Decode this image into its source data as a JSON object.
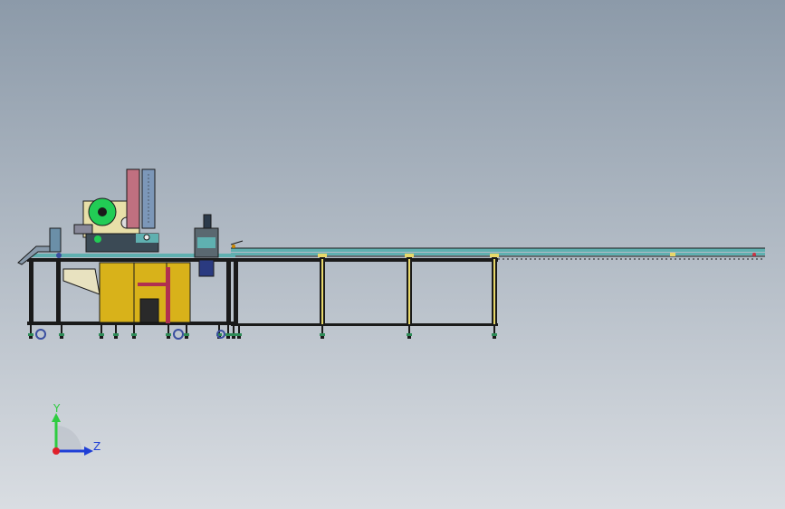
{
  "viewport": {
    "background_top": "#8c9aa9",
    "background_bottom": "#d9dde2"
  },
  "model": {
    "frame_color": "#1a1a1a",
    "cabinet_color": "#d8b21a",
    "leg_accent_color": "#e8d86a",
    "rail_color": "#5fb0b0",
    "roller_disc_color": "#22cc55",
    "tower_red_color": "#c07080",
    "tower_blue_color": "#7c97b8",
    "motor_color": "#5a6870",
    "foot_color": "#2e8b57",
    "caster_color": "#3a4fa0",
    "sheet_color": "#e8dfa8"
  },
  "triad": {
    "y_label": "Y",
    "z_label": "Z",
    "y_color": "#2ecc40",
    "z_color": "#1f3fd6",
    "x_color": "#e0202a"
  }
}
